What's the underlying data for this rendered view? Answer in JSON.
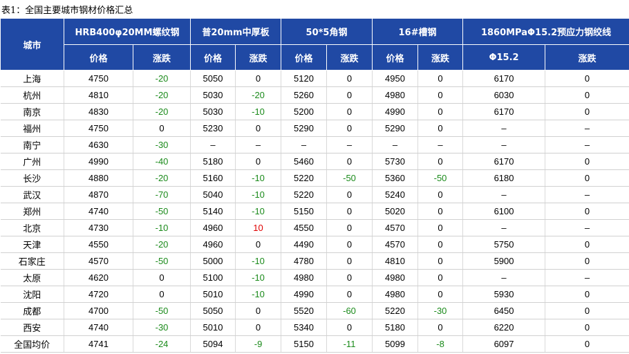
{
  "caption": "表1：全国主要城市钢材价格汇总",
  "header": {
    "city": "城市",
    "groups": [
      "HRB400φ20MM螺纹钢",
      "普20mm中厚板",
      "50*5角钢",
      "16#槽钢",
      "1860MPaΦ15.2预应力钢绞线"
    ],
    "sub": [
      "价格",
      "涨跌",
      "价格",
      "涨跌",
      "价格",
      "涨跌",
      "价格",
      "涨跌",
      "Φ15.2",
      "涨跌"
    ]
  },
  "rows": [
    [
      "上海",
      "4750",
      "-20",
      "5050",
      "0",
      "5120",
      "0",
      "4950",
      "0",
      "6170",
      "0"
    ],
    [
      "杭州",
      "4810",
      "-20",
      "5030",
      "-20",
      "5260",
      "0",
      "4980",
      "0",
      "6030",
      "0"
    ],
    [
      "南京",
      "4830",
      "-20",
      "5030",
      "-10",
      "5200",
      "0",
      "4990",
      "0",
      "6170",
      "0"
    ],
    [
      "福州",
      "4750",
      "0",
      "5230",
      "0",
      "5290",
      "0",
      "5290",
      "0",
      "–",
      "–"
    ],
    [
      "南宁",
      "4630",
      "-30",
      "–",
      "–",
      "–",
      "–",
      "–",
      "–",
      "–",
      "–"
    ],
    [
      "广州",
      "4990",
      "-40",
      "5180",
      "0",
      "5460",
      "0",
      "5730",
      "0",
      "6170",
      "0"
    ],
    [
      "长沙",
      "4880",
      "-20",
      "5160",
      "-10",
      "5220",
      "-50",
      "5360",
      "-50",
      "6180",
      "0"
    ],
    [
      "武汉",
      "4870",
      "-70",
      "5040",
      "-10",
      "5220",
      "0",
      "5240",
      "0",
      "–",
      "–"
    ],
    [
      "郑州",
      "4740",
      "-50",
      "5140",
      "-10",
      "5150",
      "0",
      "5020",
      "0",
      "6100",
      "0"
    ],
    [
      "北京",
      "4730",
      "-10",
      "4960",
      "10",
      "4550",
      "0",
      "4570",
      "0",
      "–",
      "–"
    ],
    [
      "天津",
      "4550",
      "-20",
      "4960",
      "0",
      "4490",
      "0",
      "4570",
      "0",
      "5750",
      "0"
    ],
    [
      "石家庄",
      "4570",
      "-50",
      "5000",
      "-10",
      "4780",
      "0",
      "4810",
      "0",
      "5900",
      "0"
    ],
    [
      "太原",
      "4620",
      "0",
      "5100",
      "-10",
      "4980",
      "0",
      "4980",
      "0",
      "–",
      "–"
    ],
    [
      "沈阳",
      "4720",
      "0",
      "5010",
      "-10",
      "4990",
      "0",
      "4980",
      "0",
      "5930",
      "0"
    ],
    [
      "成都",
      "4700",
      "-50",
      "5050",
      "0",
      "5520",
      "-60",
      "5220",
      "-30",
      "6450",
      "0"
    ],
    [
      "西安",
      "4740",
      "-30",
      "5010",
      "0",
      "5340",
      "0",
      "5180",
      "0",
      "6220",
      "0"
    ],
    [
      "全国均价",
      "4741",
      "-24",
      "5094",
      "-9",
      "5150",
      "-11",
      "5099",
      "-8",
      "6097",
      "0"
    ]
  ]
}
